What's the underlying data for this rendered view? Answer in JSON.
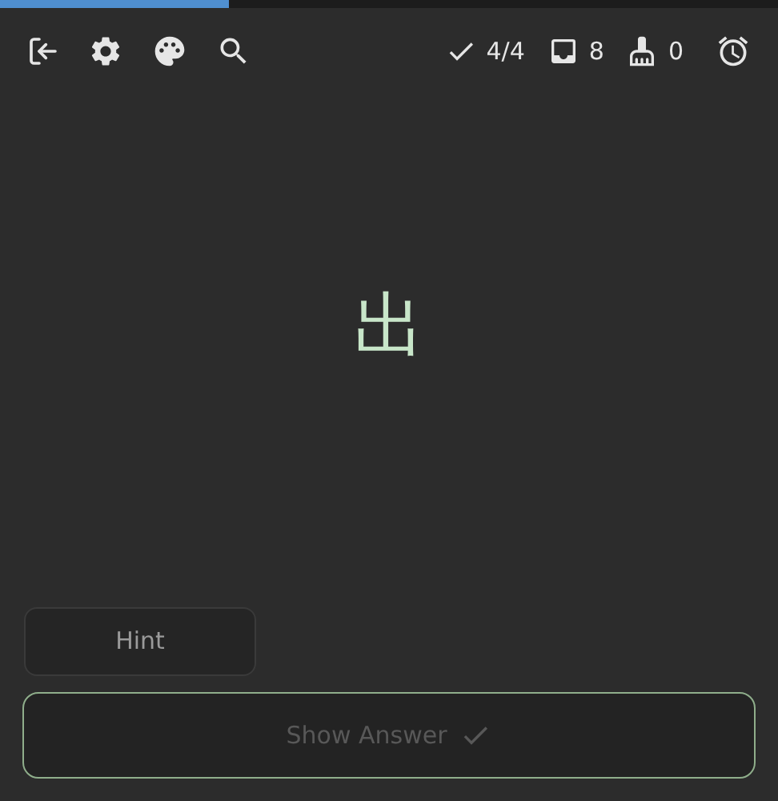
{
  "progress": {
    "level": 0.295
  },
  "stats": [
    {
      "kind": "done",
      "value": "4/4"
    },
    {
      "kind": "inbox",
      "value": "8"
    },
    {
      "kind": "sweep",
      "value": "0"
    }
  ],
  "card": {
    "front": "出"
  },
  "hint_button": {
    "label": "Hint"
  },
  "answer_button": {
    "label": "Show Answer",
    "disabled": true
  }
}
